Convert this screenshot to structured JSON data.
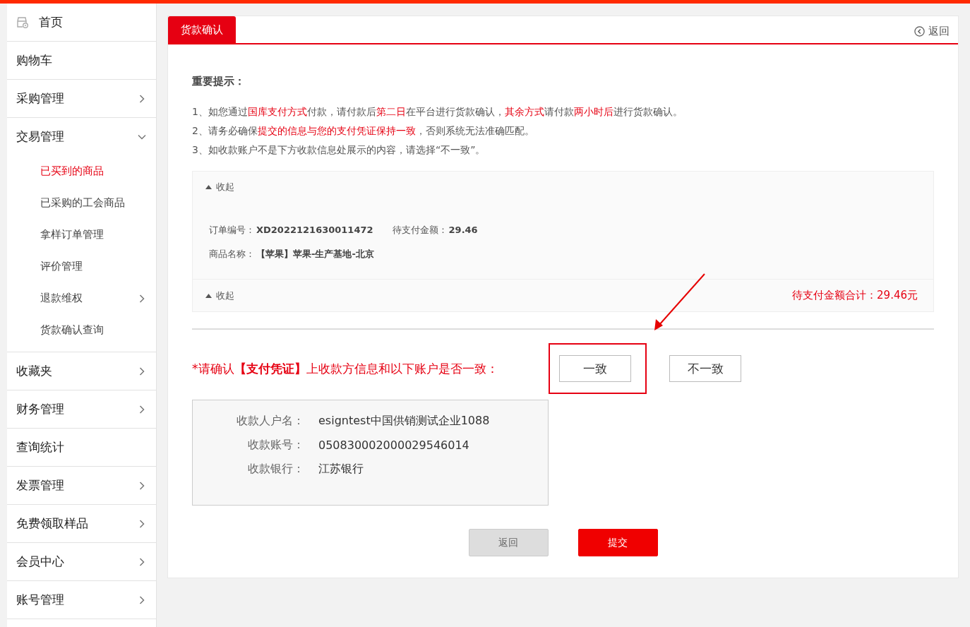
{
  "sidebar": {
    "items": [
      {
        "label": "首页",
        "kind": "home"
      },
      {
        "label": "购物车",
        "kind": "link"
      },
      {
        "label": "采购管理",
        "kind": "menu",
        "expanded": false
      },
      {
        "label": "交易管理",
        "kind": "menu",
        "expanded": true,
        "children": [
          {
            "label": "已买到的商品",
            "kind": "link",
            "selected": true
          },
          {
            "label": "已采购的工会商品",
            "kind": "link",
            "selected": false
          },
          {
            "label": "拿样订单管理",
            "kind": "link",
            "selected": false
          },
          {
            "label": "评价管理",
            "kind": "link",
            "selected": false
          },
          {
            "label": "退款维权",
            "kind": "menu",
            "selected": false,
            "expanded": false
          },
          {
            "label": "货款确认查询",
            "kind": "link",
            "selected": false
          }
        ]
      },
      {
        "label": "收藏夹",
        "kind": "menu",
        "expanded": false
      },
      {
        "label": "财务管理",
        "kind": "menu",
        "expanded": false
      },
      {
        "label": "查询统计",
        "kind": "link"
      },
      {
        "label": "发票管理",
        "kind": "menu",
        "expanded": false
      },
      {
        "label": "免费领取样品",
        "kind": "menu",
        "expanded": false
      },
      {
        "label": "会员中心",
        "kind": "menu",
        "expanded": false
      },
      {
        "label": "账号管理",
        "kind": "menu",
        "expanded": false
      }
    ]
  },
  "tab": {
    "label": "货款确认",
    "selected": true
  },
  "back_link": "返回",
  "notice": {
    "title": "重要提示：",
    "lines": [
      "1、如您通过**国库支付方式**付款，请付款后**第二日**在平台进行货款确认，**其余方式**请付款**两小时后**进行货款确认。",
      "2、请务必确保**提交的信息与您的支付凭证保持一致**，否则系统无法准确匹配。",
      "3、如收款账户不是下方收款信息处展示的内容，请选择“不一致”。"
    ]
  },
  "order_panel": {
    "toggle_top": "收起",
    "rows": [
      [
        {
          "label": "订单编号：",
          "value": "XD2022121630011472"
        },
        {
          "label": "待支付金额：",
          "value": "29.46"
        }
      ],
      [
        {
          "label": "商品名称：",
          "value": "【苹果】苹果-生产基地-北京"
        }
      ]
    ],
    "toggle_bottom": "收起",
    "total": "待支付金额合计：29.46元"
  },
  "confirm": {
    "prompt": "*请确认**【支付凭证】**上收款方信息和以下账户是否一致：",
    "options": [
      {
        "label": "一致",
        "selected": false,
        "highlighted": true
      },
      {
        "label": "不一致",
        "selected": false,
        "highlighted": false
      }
    ]
  },
  "payee": [
    {
      "label": "收款人户名：",
      "value": "esigntest中国供销测试企业1088"
    },
    {
      "label": "收款账号：",
      "value": "050830002000029546014"
    },
    {
      "label": "收款银行：",
      "value": "江苏银行"
    }
  ],
  "buttons": [
    {
      "label": "返回",
      "kind": "secondary"
    },
    {
      "label": "提交",
      "kind": "primary"
    }
  ]
}
